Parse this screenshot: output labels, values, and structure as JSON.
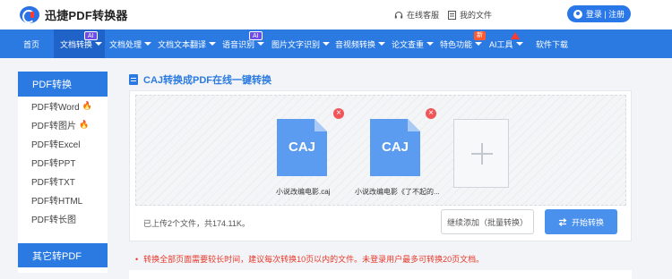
{
  "header": {
    "logo_text": "迅捷PDF转换器",
    "service_label": "在线客服",
    "files_label": "我的文件",
    "login_label": "登录 | 注册"
  },
  "nav": {
    "items": [
      {
        "label": "首页"
      },
      {
        "label": "文档转换",
        "badge": "AI"
      },
      {
        "label": "文档处理"
      },
      {
        "label": "文档文本翻译"
      },
      {
        "label": "语音识别",
        "badge": "AI"
      },
      {
        "label": "图片文字识别"
      },
      {
        "label": "音视频转换"
      },
      {
        "label": "论文查重"
      },
      {
        "label": "特色功能",
        "badge": "新"
      },
      {
        "label": "AI工具"
      },
      {
        "label": "软件下载"
      }
    ]
  },
  "sidebar": {
    "heading": "PDF转换",
    "items": [
      {
        "label": "PDF转Word",
        "hot": true
      },
      {
        "label": "PDF转图片",
        "hot": true
      },
      {
        "label": "PDF转Excel"
      },
      {
        "label": "PDF转PPT"
      },
      {
        "label": "PDF转TXT"
      },
      {
        "label": "PDF转HTML"
      },
      {
        "label": "PDF转长图"
      }
    ],
    "heading2": "其它转PDF",
    "hot_icon": "fire-icon"
  },
  "main": {
    "title": "CAJ转换成PDF在线一键转换",
    "files": [
      {
        "type_label": "CAJ",
        "name": "小说改编电影.caj"
      },
      {
        "type_label": "CAJ",
        "name": "小说改编电影《了不起的..."
      }
    ],
    "upload_info": "已上传2个文件，共174.11K。",
    "add_more_label": "继续添加（批量转换）",
    "start_label": "开始转换",
    "note": "转换全部页面需要较长时间，建议每次转换10页以内的文件。未登录用户最多可转换20页文档。"
  },
  "colors": {
    "primary": "#2a7ae2",
    "file_icon": "#5b9bf0",
    "danger": "#e8392b"
  }
}
